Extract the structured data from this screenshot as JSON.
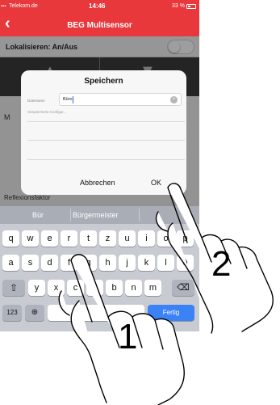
{
  "status_bar": {
    "carrier": "Telekom.de",
    "time": "14:46",
    "battery": "33 %"
  },
  "nav": {
    "back_icon": "chevron-left-icon",
    "title": "BEG Multisensor"
  },
  "localize": {
    "label": "Lokalisieren: An/Aus",
    "toggle_on": false
  },
  "list_behind": {
    "reflex_label": "Reflexionsfaktor"
  },
  "dialog": {
    "title": "Speichern",
    "field_label": "Dateiname",
    "field_value": "Büro",
    "saved_label": "Gespeicherte Konfigur...",
    "cancel_label": "Abbrechen",
    "ok_label": "OK"
  },
  "suggestions": [
    "Bür",
    "Bürgermeister"
  ],
  "keyboard": {
    "row1": [
      "q",
      "w",
      "e",
      "r",
      "t",
      "z",
      "u",
      "i",
      "o",
      "p"
    ],
    "row2": [
      "a",
      "s",
      "d",
      "f",
      "g",
      "h",
      "j",
      "k",
      "l",
      "ö"
    ],
    "row3": [
      "y",
      "x",
      "c",
      "v",
      "b",
      "n",
      "m"
    ],
    "shift_icon": "shift-icon",
    "backspace_icon": "backspace-icon",
    "numbers_label": "123",
    "globe_icon": "globe-icon",
    "done_label": "Fertig"
  },
  "steps": {
    "one": "1",
    "two": "2"
  },
  "colors": {
    "accent": "#e8383b",
    "done_key": "#3b82f6"
  }
}
